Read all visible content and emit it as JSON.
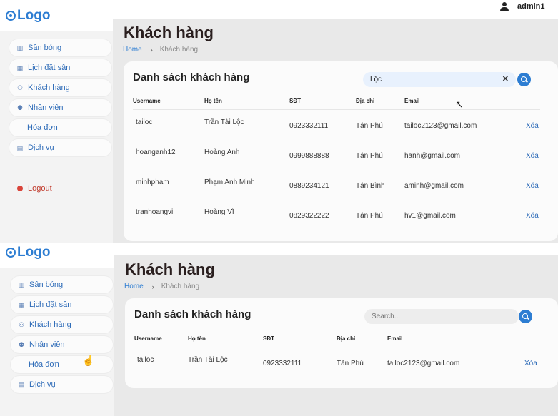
{
  "app": {
    "logo": "Logo",
    "user": "admin1"
  },
  "sidebar": {
    "items": [
      {
        "label": "Sân bóng",
        "icon": "map-icon"
      },
      {
        "label": "Lịch đặt sân",
        "icon": "calendar-icon"
      },
      {
        "label": "Khách hàng",
        "icon": "users-icon"
      },
      {
        "label": "Nhân viên",
        "icon": "staff-icon"
      },
      {
        "label": "Hóa đơn",
        "icon": ""
      },
      {
        "label": "Dịch vụ",
        "icon": "service-icon"
      }
    ],
    "logout": "Logout"
  },
  "page": {
    "title": "Khách hàng",
    "breadcrumb": {
      "home": "Home",
      "current": "Khách hàng"
    }
  },
  "customers": {
    "title": "Danh sách khách hàng",
    "columns": [
      "Username",
      "Họ tên",
      "SĐT",
      "Địa chỉ",
      "Email"
    ],
    "delete_label": "Xóa"
  },
  "screen_a": {
    "search_value": "Lộc",
    "rows": [
      {
        "username": "tailoc",
        "name": "Trần Tài Lộc",
        "phone": "0923332111",
        "address": "Tân Phú",
        "email": "tailoc2123@gmail.com"
      },
      {
        "username": "hoanganh12",
        "name": "Hoàng Anh",
        "phone": "0999888888",
        "address": "Tân Phú",
        "email": "hanh@gmail.com"
      },
      {
        "username": "minhpham",
        "name": "Phạm Anh Minh",
        "phone": "0889234121",
        "address": "Tân Bình",
        "email": "aminh@gmail.com"
      },
      {
        "username": "tranhoangvi",
        "name": "Hoàng Vĩ",
        "phone": "0829322222",
        "address": "Tân Phú",
        "email": "hv1@gmail.com"
      }
    ]
  },
  "screen_b": {
    "search_placeholder": "Search...",
    "rows": [
      {
        "username": "tailoc",
        "name": "Trần Tài Lộc",
        "phone": "0923332111",
        "address": "Tân Phú",
        "email": "tailoc2123@gmail.com"
      }
    ]
  }
}
